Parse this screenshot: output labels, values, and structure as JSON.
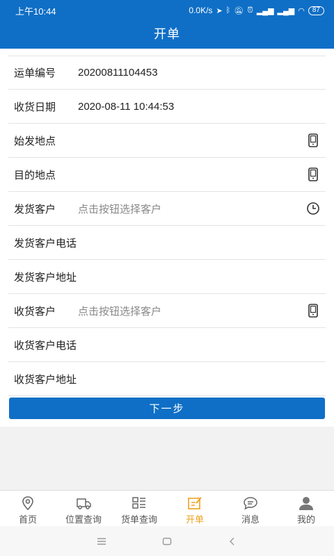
{
  "status_bar": {
    "time": "上午10:44",
    "network_speed": "0.0K/s",
    "battery": "87"
  },
  "header": {
    "title": "开单"
  },
  "form": {
    "rows": [
      {
        "label": "运单编号",
        "value": "20200811104453"
      },
      {
        "label": "收货日期",
        "value": "2020-08-11 10:44:53"
      },
      {
        "label": "始发地点",
        "value": "",
        "icon": "phone-book-icon"
      },
      {
        "label": "目的地点",
        "value": "",
        "icon": "phone-book-icon"
      },
      {
        "label": "发货客户",
        "placeholder": "点击按钮选择客户",
        "icon": "clock-icon"
      },
      {
        "label": "发货客户电话",
        "value": ""
      },
      {
        "label": "发货客户地址",
        "value": ""
      },
      {
        "label": "收货客户",
        "placeholder": "点击按钮选择客户",
        "icon": "phone-book-icon"
      },
      {
        "label": "收货客户电话",
        "value": ""
      },
      {
        "label": "收货客户地址",
        "value": ""
      }
    ]
  },
  "next_button": {
    "label": "下一步"
  },
  "tabbar": {
    "active_color": "#f0a020",
    "tabs": [
      {
        "label": "首页",
        "icon": "location-pin-icon"
      },
      {
        "label": "位置查询",
        "icon": "truck-icon"
      },
      {
        "label": "货单查询",
        "icon": "list-grid-icon"
      },
      {
        "label": "开单",
        "icon": "edit-note-icon",
        "active": true
      },
      {
        "label": "消息",
        "icon": "chat-bubble-icon"
      },
      {
        "label": "我的",
        "icon": "user-icon"
      }
    ]
  },
  "theme": {
    "primary": "#0f6fc6"
  }
}
